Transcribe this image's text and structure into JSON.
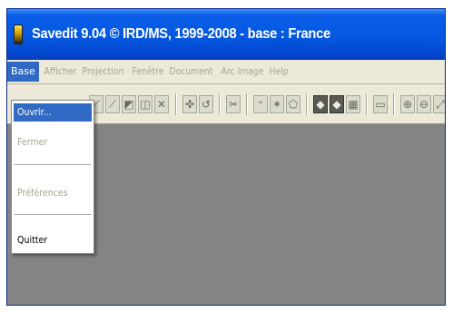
{
  "window": {
    "title": "Savedit 9.04 © IRD/MS, 1999-2008  -  base : France"
  },
  "menubar": {
    "items": [
      {
        "label": "Base"
      },
      {
        "label": "Afficher"
      },
      {
        "label": "Projection"
      },
      {
        "label": "Fenêtre"
      },
      {
        "label": "Document"
      },
      {
        "label": "Arc"
      },
      {
        "label": "Image"
      },
      {
        "label": "Help"
      }
    ]
  },
  "dropdown": {
    "open_menu": "Base",
    "items": [
      {
        "label": "Ouvrir...",
        "state": "highlighted"
      },
      {
        "label": "Fermer",
        "state": "disabled"
      },
      {
        "label": "Préférences",
        "state": "disabled"
      },
      {
        "label": "Quitter",
        "state": "enabled"
      }
    ]
  },
  "toolbar": {
    "icons": [
      "line-tool-icon",
      "draw-tool-icon",
      "select-tool-icon",
      "erase-tool-icon",
      "delete-tool-icon",
      "node-tool-icon",
      "undo-icon",
      "cut-icon",
      "pin-icon",
      "star-icon",
      "polygon-icon",
      "fill-icon",
      "region-icon",
      "grid-icon",
      "frame-icon",
      "zoom-in-icon",
      "zoom-out-icon",
      "pan-icon"
    ]
  },
  "colors": {
    "titlebar": "#0558e0",
    "menu_highlight": "#316ac5",
    "workspace": "#848484",
    "menubar": "#ece9d8",
    "disabled_text": "#a7a492"
  }
}
